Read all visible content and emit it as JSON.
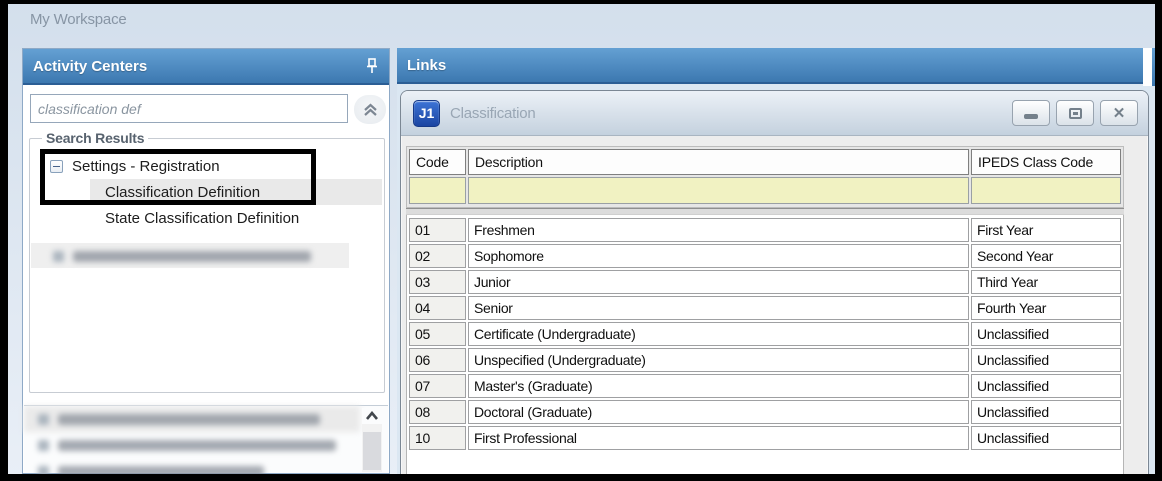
{
  "workspace": {
    "title": "My Workspace"
  },
  "activity_centers": {
    "header": "Activity Centers",
    "search_value": "classification def",
    "group_label": "Search Results",
    "tree": {
      "parent": "Settings - Registration",
      "children": [
        "Classification Definition",
        "State Classification Definition"
      ],
      "selected": "Classification Definition",
      "blurred_item_count": 1
    },
    "bottom_list": {
      "blurred_row_count": 3
    }
  },
  "links": {
    "header": "Links"
  },
  "classification_window": {
    "logo": "J1",
    "title": "Classification"
  },
  "grid": {
    "columns": [
      "Code",
      "Description",
      "IPEDS Class Code"
    ],
    "filter_row": [
      "",
      "",
      ""
    ],
    "rows": [
      {
        "code": "01",
        "description": "Freshmen",
        "ipeds": "First Year"
      },
      {
        "code": "02",
        "description": "Sophomore",
        "ipeds": "Second Year"
      },
      {
        "code": "03",
        "description": "Junior",
        "ipeds": "Third Year"
      },
      {
        "code": "04",
        "description": "Senior",
        "ipeds": "Fourth Year"
      },
      {
        "code": "05",
        "description": "Certificate (Undergraduate)",
        "ipeds": "Unclassified"
      },
      {
        "code": "06",
        "description": "Unspecified (Undergraduate)",
        "ipeds": "Unclassified"
      },
      {
        "code": "07",
        "description": "Master's (Graduate)",
        "ipeds": "Unclassified"
      },
      {
        "code": "08",
        "description": "Doctoral (Graduate)",
        "ipeds": "Unclassified"
      },
      {
        "code": "10",
        "description": "First Professional",
        "ipeds": "Unclassified"
      }
    ]
  },
  "colors": {
    "header_blue_top": "#64a0d3",
    "header_blue_bottom": "#3c78b0",
    "filter_yellow": "#f1f2c2",
    "logo_blue": "#1c45a2",
    "annotation_black": "#000000"
  },
  "icons": {
    "close_glyph": "✕"
  }
}
